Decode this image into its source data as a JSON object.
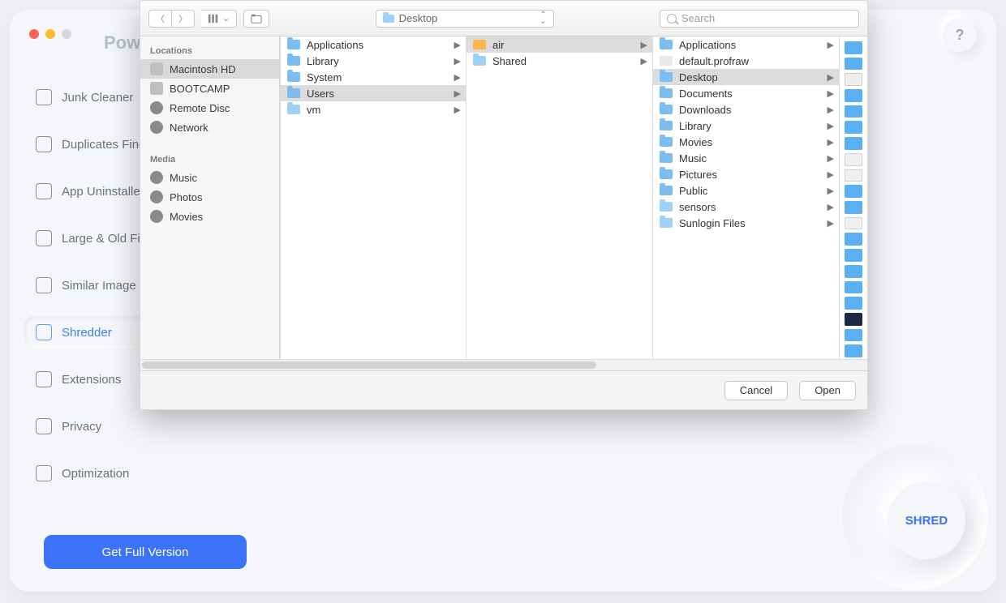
{
  "app": {
    "title": "PowerMyMac",
    "help": "?",
    "cta_label": "Get Full Version",
    "shred_label": "SHRED"
  },
  "nav": {
    "items": [
      {
        "label": "Junk Cleaner",
        "active": false
      },
      {
        "label": "Duplicates Finder",
        "active": false
      },
      {
        "label": "App Uninstaller",
        "active": false
      },
      {
        "label": "Large & Old Files",
        "active": false
      },
      {
        "label": "Similar Image Finder",
        "active": false
      },
      {
        "label": "Shredder",
        "active": true
      },
      {
        "label": "Extensions",
        "active": false
      },
      {
        "label": "Privacy",
        "active": false
      },
      {
        "label": "Optimization",
        "active": false
      }
    ]
  },
  "dialog": {
    "path_label": "Desktop",
    "search_placeholder": "Search",
    "cancel_label": "Cancel",
    "open_label": "Open",
    "sidebar": {
      "locations_header": "Locations",
      "locations": [
        {
          "label": "Macintosh HD",
          "selected": true
        },
        {
          "label": "BOOTCAMP",
          "selected": false
        },
        {
          "label": "Remote Disc",
          "selected": false
        },
        {
          "label": "Network",
          "selected": false
        }
      ],
      "media_header": "Media",
      "media": [
        {
          "label": "Music"
        },
        {
          "label": "Photos"
        },
        {
          "label": "Movies"
        }
      ]
    },
    "columns": {
      "col1": [
        {
          "label": "Applications",
          "kind": "sys",
          "has_children": true,
          "selected": false
        },
        {
          "label": "Library",
          "kind": "sys",
          "has_children": true,
          "selected": false
        },
        {
          "label": "System",
          "kind": "sys",
          "has_children": true,
          "selected": false
        },
        {
          "label": "Users",
          "kind": "sys",
          "has_children": true,
          "selected": true
        },
        {
          "label": "vm",
          "kind": "folder",
          "has_children": true,
          "selected": false
        }
      ],
      "col2": [
        {
          "label": "air",
          "kind": "home",
          "has_children": true,
          "selected": true
        },
        {
          "label": "Shared",
          "kind": "folder",
          "has_children": true,
          "selected": false
        }
      ],
      "col3": [
        {
          "label": "Applications",
          "kind": "sys",
          "has_children": true,
          "selected": false
        },
        {
          "label": "default.profraw",
          "kind": "doc",
          "has_children": false,
          "selected": false
        },
        {
          "label": "Desktop",
          "kind": "sys",
          "has_children": true,
          "selected": true
        },
        {
          "label": "Documents",
          "kind": "sys",
          "has_children": true,
          "selected": false
        },
        {
          "label": "Downloads",
          "kind": "sys",
          "has_children": true,
          "selected": false
        },
        {
          "label": "Library",
          "kind": "sys",
          "has_children": true,
          "selected": false
        },
        {
          "label": "Movies",
          "kind": "sys",
          "has_children": true,
          "selected": false
        },
        {
          "label": "Music",
          "kind": "sys",
          "has_children": true,
          "selected": false
        },
        {
          "label": "Pictures",
          "kind": "sys",
          "has_children": true,
          "selected": false
        },
        {
          "label": "Public",
          "kind": "sys",
          "has_children": true,
          "selected": false
        },
        {
          "label": "sensors",
          "kind": "folder",
          "has_children": true,
          "selected": false
        },
        {
          "label": "Sunlogin Files",
          "kind": "folder",
          "has_children": true,
          "selected": false
        }
      ]
    }
  }
}
